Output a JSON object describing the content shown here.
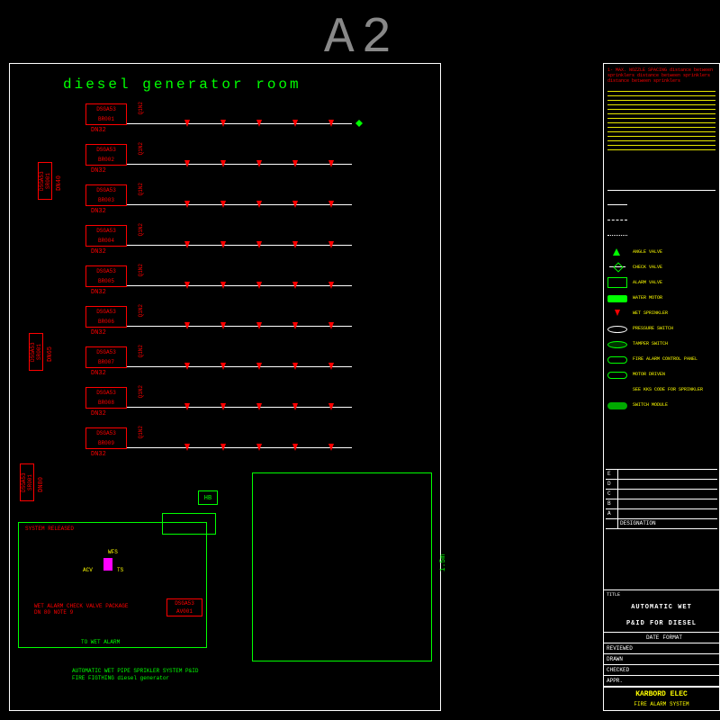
{
  "sheet": "A2",
  "room_title": "diesel  generator  room",
  "branches": [
    {
      "tag1": "DSGA53",
      "tag2": "BR001",
      "dn": "DN32",
      "vert": "Q1N2"
    },
    {
      "tag1": "DSGA53",
      "tag2": "BR002",
      "dn": "DN32",
      "vert": "Q1N2"
    },
    {
      "tag1": "DSGA53",
      "tag2": "BR003",
      "dn": "DN32",
      "vert": "Q1N2"
    },
    {
      "tag1": "DSGA53",
      "tag2": "BR004",
      "dn": "DN32",
      "vert": "Q1N2"
    },
    {
      "tag1": "DSGA53",
      "tag2": "BR005",
      "dn": "DN32",
      "vert": "Q1N2"
    },
    {
      "tag1": "DSGA53",
      "tag2": "BR006",
      "dn": "DN32",
      "vert": "Q1N2"
    },
    {
      "tag1": "DSGA53",
      "tag2": "BR007",
      "dn": "DN32",
      "vert": "Q1N2"
    },
    {
      "tag1": "DSGA53",
      "tag2": "BR008",
      "dn": "DN32",
      "vert": "Q1N2"
    },
    {
      "tag1": "DSGA53",
      "tag2": "BR009",
      "dn": "DN32",
      "vert": "Q1N2"
    }
  ],
  "mains": [
    {
      "tag": "DSGA53 SR001",
      "dn": "DN40"
    },
    {
      "tag": "DSGA53 SR001",
      "dn": "DN65"
    },
    {
      "tag": "DSGA53 SR001",
      "dn": "DN80"
    }
  ],
  "hb_label": "HB",
  "lower_dim": "1.5m",
  "system_released": "SYSTEM RELEASED",
  "alarm_package": "WET ALARM CHECK VALVE PACKAGE\nDN 80\nNOTE 9",
  "to_label": "TO WET\nALARM",
  "small_tag": {
    "t1": "DSGA53",
    "t2": "AV001"
  },
  "caption_l1": "AUTOMATIC WET PIPE SPRIKLER SYSTEM P&ID",
  "caption_l2": "FIRE FIGTHING diesel generator",
  "notes_header": "1- MAX. NOZZLE SPACING\ndistance between sprinklers\ndistance between sprinklers\ndistance between sprinklers",
  "legend": [
    {
      "sym": "line",
      "label": ""
    },
    {
      "sym": "dash",
      "label": ""
    },
    {
      "sym": "dot",
      "label": ""
    },
    {
      "sym": "tri",
      "label": "ANGLE VALVE"
    },
    {
      "sym": "check",
      "label": "CHECK VALVE"
    },
    {
      "sym": "alarm",
      "label": "ALARM VALVE"
    },
    {
      "sym": "motor",
      "label": "WATER MOTOR"
    },
    {
      "sym": "sprk",
      "label": "WET SPRINKLER"
    },
    {
      "sym": "oval",
      "label": "PRESSURE SWITCH"
    },
    {
      "sym": "ovalg",
      "label": "TAMPER SWITCH"
    },
    {
      "sym": "pill",
      "label": "FIRE ALARM CONTROL PANEL"
    },
    {
      "sym": "pill",
      "label": "MOTOR DRIVEN"
    },
    {
      "sym": "text",
      "label": "SEE KKS CODE FOR SPRINKLER"
    },
    {
      "sym": "pillf",
      "label": "SWITCH MODULE"
    }
  ],
  "revisions": [
    "E",
    "D",
    "C",
    "B",
    "A"
  ],
  "rev_header": "DESIGNATION",
  "title_block": {
    "title_l1": "AUTOMATIC WET",
    "title_l2": "P&ID FOR DIESEL",
    "rows": [
      [
        "",
        "DATE",
        "FORMAT"
      ],
      [
        "REVIEWED",
        "",
        ""
      ],
      [
        "DRAWN",
        "",
        ""
      ],
      [
        "CHECKED",
        "",
        ""
      ],
      [
        "APPR.",
        "",
        ""
      ]
    ],
    "company": "KARBORD ELEC",
    "subtitle": "FIRE ALARM SYSTEM"
  }
}
